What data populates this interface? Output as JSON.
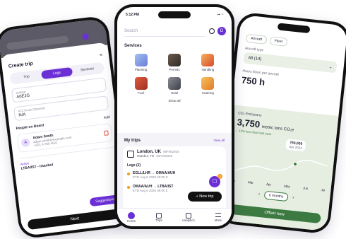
{
  "left_phone": {
    "title": "Create trip",
    "tabs": [
      "Trip",
      "Legs",
      "Services"
    ],
    "active_tab": 1,
    "field1": {
      "label": "Callsign",
      "value": "A6EJG"
    },
    "field2": {
      "label": "ATC Route (Optional)",
      "value": "N/A"
    },
    "people_label": "People on Board",
    "add_label": "Add",
    "person": {
      "initial": "A",
      "name": "Adam Smith",
      "email": "adam.smith@example.com",
      "phone": "+971 4 789 4521"
    },
    "route_title": "LTBA/IST - Istanbul",
    "route_badge": "Active",
    "suggestions_label": "Suggestions",
    "next_label": "Next",
    "close_glyph": "×"
  },
  "mid_phone": {
    "status_time": "5:12 PM",
    "search_placeholder": "Search",
    "avatar_initial": "D",
    "services_title": "Services",
    "services": [
      "Planning",
      "Permits",
      "Handling",
      "Fuel",
      "Hotel",
      "Catering"
    ],
    "show_all": "Show all",
    "trips_title": "My trips",
    "view_all": "View all",
    "trip": {
      "title": "London, UK",
      "date": "09Feb2025",
      "sub": "Istanbul, TR",
      "sub_date": "01Feb2025"
    },
    "legs_label": "Legs (2)",
    "legs": [
      {
        "route": "EGLL/LHR → OMAA/AUH",
        "time": "ETD Aug 5 2025 20:00 Z"
      },
      {
        "route": "OMAA/AUH → LTBA/IST",
        "time": "ETD Aug 6 2025 09:00 Z"
      }
    ],
    "new_trip_label": "New trip",
    "fab_badge": "4",
    "nav": [
      "Home",
      "Trips",
      "Analytics",
      "More"
    ]
  },
  "right_phone": {
    "chips": [
      "Aircraft",
      "Fleet"
    ],
    "aircraft_type_label": "Aircraft type",
    "aircraft_type_value": "All (14)",
    "hours_label": "Hours flown per aircraft",
    "hours_value": "750 h",
    "co2_label": "CO₂ Emissions",
    "co2_value": "3,750",
    "co2_unit": "metric tons CO₂e",
    "co2_delta": "↓ 12% less than last year",
    "tooltip_value": "750,000",
    "tooltip_date": "Apr 2024",
    "months": [
      "Feb",
      "Mar",
      "Apr",
      "May",
      "Jun",
      "Jul"
    ],
    "period_label": "6 months",
    "offset_label": "Offset now"
  },
  "colors": {
    "purple": "#6b2fd6",
    "green": "#3c7a42",
    "orange": "#f59a23"
  }
}
